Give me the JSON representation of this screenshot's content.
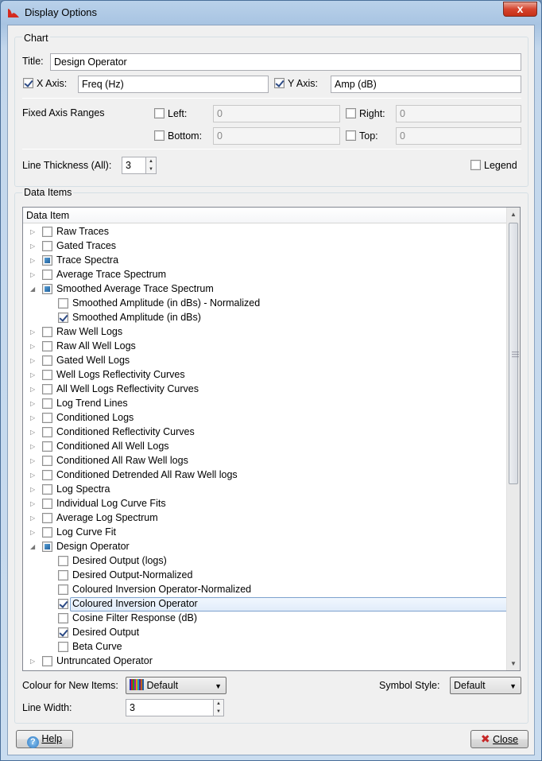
{
  "window": {
    "title": "Display Options",
    "close_glyph": "x"
  },
  "chart": {
    "group_label": "Chart",
    "title_label": "Title:",
    "title_value": "Design Operator",
    "x_axis_label": "X Axis:",
    "x_axis_checked": true,
    "x_axis_value": "Freq (Hz)",
    "y_axis_label": "Y Axis:",
    "y_axis_checked": true,
    "y_axis_value": "Amp (dB)",
    "fixed_ranges_label": "Fixed Axis Ranges",
    "left_label": "Left:",
    "left_value": "0",
    "right_label": "Right:",
    "right_value": "0",
    "bottom_label": "Bottom:",
    "bottom_value": "0",
    "top_label": "Top:",
    "top_value": "0",
    "line_thickness_label": "Line Thickness (All):",
    "line_thickness_value": "3",
    "legend_label": "Legend"
  },
  "data_items": {
    "group_label": "Data Items",
    "column_header": "Data Item",
    "rows": [
      {
        "label": "Raw Traces",
        "level": 0,
        "expander": "collapsed",
        "state": "unchecked"
      },
      {
        "label": "Gated Traces",
        "level": 0,
        "expander": "collapsed",
        "state": "unchecked"
      },
      {
        "label": "Trace Spectra",
        "level": 0,
        "expander": "collapsed",
        "state": "partial"
      },
      {
        "label": "Average Trace Spectrum",
        "level": 0,
        "expander": "collapsed",
        "state": "unchecked"
      },
      {
        "label": "Smoothed Average Trace Spectrum",
        "level": 0,
        "expander": "expanded",
        "state": "partial"
      },
      {
        "label": "Smoothed Amplitude (in dBs) - Normalized",
        "level": 1,
        "expander": "none",
        "state": "unchecked"
      },
      {
        "label": "Smoothed Amplitude (in dBs)",
        "level": 1,
        "expander": "none",
        "state": "checked"
      },
      {
        "label": "Raw Well Logs",
        "level": 0,
        "expander": "collapsed",
        "state": "unchecked"
      },
      {
        "label": "Raw All Well Logs",
        "level": 0,
        "expander": "collapsed",
        "state": "unchecked"
      },
      {
        "label": "Gated Well Logs",
        "level": 0,
        "expander": "collapsed",
        "state": "unchecked"
      },
      {
        "label": "Well Logs Reflectivity Curves",
        "level": 0,
        "expander": "collapsed",
        "state": "unchecked"
      },
      {
        "label": "All Well Logs Reflectivity Curves",
        "level": 0,
        "expander": "collapsed",
        "state": "unchecked"
      },
      {
        "label": "Log Trend Lines",
        "level": 0,
        "expander": "collapsed",
        "state": "unchecked"
      },
      {
        "label": "Conditioned Logs",
        "level": 0,
        "expander": "collapsed",
        "state": "unchecked"
      },
      {
        "label": "Conditioned Reflectivity Curves",
        "level": 0,
        "expander": "collapsed",
        "state": "unchecked"
      },
      {
        "label": "Conditioned All Well Logs",
        "level": 0,
        "expander": "collapsed",
        "state": "unchecked"
      },
      {
        "label": "Conditioned All Raw Well logs",
        "level": 0,
        "expander": "collapsed",
        "state": "unchecked"
      },
      {
        "label": "Conditioned Detrended All Raw Well logs",
        "level": 0,
        "expander": "collapsed",
        "state": "unchecked"
      },
      {
        "label": "Log Spectra",
        "level": 0,
        "expander": "collapsed",
        "state": "unchecked"
      },
      {
        "label": "Individual Log Curve Fits",
        "level": 0,
        "expander": "collapsed",
        "state": "unchecked"
      },
      {
        "label": "Average Log Spectrum",
        "level": 0,
        "expander": "collapsed",
        "state": "unchecked"
      },
      {
        "label": "Log Curve Fit",
        "level": 0,
        "expander": "collapsed",
        "state": "unchecked"
      },
      {
        "label": "Design Operator",
        "level": 0,
        "expander": "expanded",
        "state": "partial"
      },
      {
        "label": "Desired Output (logs)",
        "level": 1,
        "expander": "none",
        "state": "unchecked"
      },
      {
        "label": "Desired Output-Normalized",
        "level": 1,
        "expander": "none",
        "state": "unchecked"
      },
      {
        "label": "Coloured Inversion Operator-Normalized",
        "level": 1,
        "expander": "none",
        "state": "unchecked"
      },
      {
        "label": "Coloured Inversion Operator",
        "level": 1,
        "expander": "none",
        "state": "checked",
        "selected": true
      },
      {
        "label": "Cosine Filter Response (dB)",
        "level": 1,
        "expander": "none",
        "state": "unchecked"
      },
      {
        "label": "Desired Output",
        "level": 1,
        "expander": "none",
        "state": "checked"
      },
      {
        "label": "Beta Curve",
        "level": 1,
        "expander": "none",
        "state": "unchecked"
      },
      {
        "label": "Untruncated Operator",
        "level": 0,
        "expander": "collapsed",
        "state": "unchecked"
      }
    ],
    "colour_label": "Colour for New Items:",
    "colour_value": "Default",
    "symbol_label": "Symbol Style:",
    "symbol_value": "Default",
    "line_width_label": "Line Width:",
    "line_width_value": "3"
  },
  "footer": {
    "help_label": "Help",
    "close_label": "Close"
  }
}
